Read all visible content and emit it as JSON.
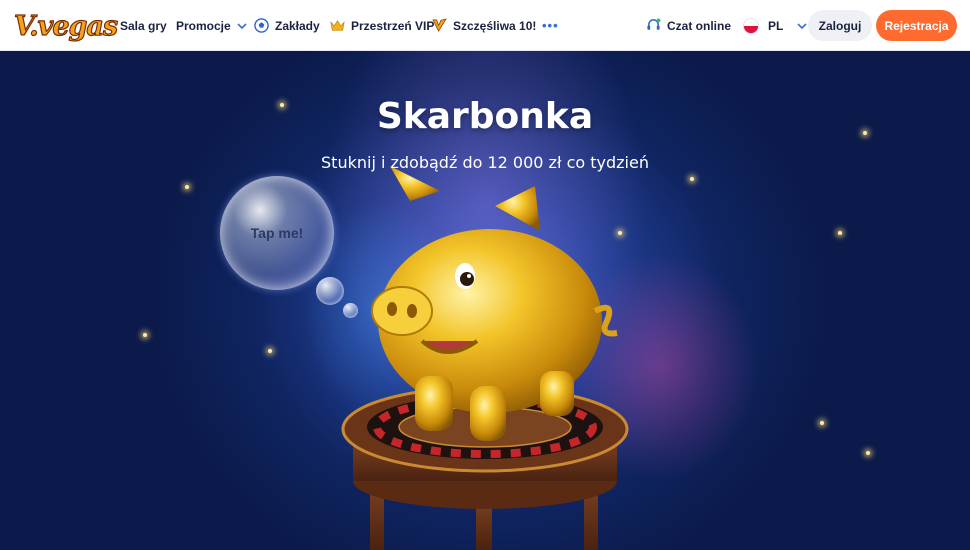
{
  "header": {
    "logo_text": "V.vegas",
    "nav": [
      {
        "label": "Sala gry",
        "icon": ""
      },
      {
        "label": "Promocje",
        "icon": "chevron-down-icon"
      },
      {
        "label": "Zakłady",
        "icon": "soccer-ball-icon"
      },
      {
        "label": "Przestrzeń VIP",
        "icon": "crown-icon"
      },
      {
        "label": "Szczęśliwa 10!",
        "icon": "v-logo-icon"
      }
    ],
    "more_label": "•••",
    "chat_label": "Czat online",
    "language": "PL",
    "login_label": "Zaloguj",
    "register_label": "Rejestracja"
  },
  "hero": {
    "title": "Skarbonka",
    "subtitle": "Stuknij i zdobądź do 12 000 zł co tydzień",
    "bubble_label": "Tap me!"
  },
  "colors": {
    "accent": "#ff6a2e",
    "brand_gold": "#f4a21d",
    "hero_bg": "#0b1a4a"
  }
}
